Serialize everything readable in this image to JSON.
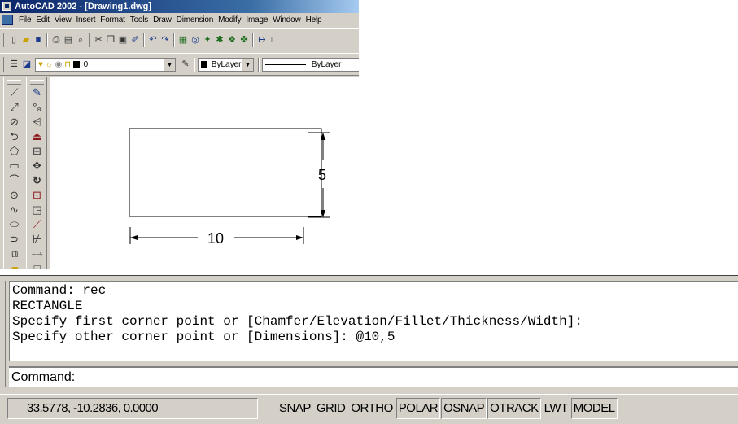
{
  "window": {
    "title": "AutoCAD 2002 - [Drawing1.dwg]"
  },
  "menu": {
    "items": [
      "File",
      "Edit",
      "View",
      "Insert",
      "Format",
      "Tools",
      "Draw",
      "Dimension",
      "Modify",
      "Image",
      "Window",
      "Help"
    ]
  },
  "standard_toolbar": {
    "icons": [
      "new-icon",
      "open-icon",
      "save-icon",
      "print-icon",
      "print-preview-icon",
      "find-icon",
      "cut-icon",
      "copy-icon",
      "paste-icon",
      "match-properties-icon",
      "undo-icon",
      "redo-icon",
      "hyperlink-icon",
      "browser-icon",
      "realtime-pan-icon",
      "realtime-zoom-icon",
      "zoom-icon",
      "properties-icon",
      "distance-icon",
      "ucs-icon"
    ]
  },
  "properties_toolbar": {
    "layer_value": "0",
    "color_value": "ByLayer",
    "linetype_value": "ByLayer"
  },
  "drawing": {
    "width_label": "10",
    "height_label": "5",
    "colors": {
      "geometry": "#000000",
      "background": "#ffffff"
    }
  },
  "command_window": {
    "history": [
      "Command: rec",
      "RECTANGLE",
      "Specify first corner point or [Chamfer/Elevation/Fillet/Thickness/Width]:",
      "Specify other corner point or [Dimensions]: @10,5"
    ],
    "prompt": "Command:"
  },
  "status_bar": {
    "coordinates": "33.5778, -10.2836, 0.0000",
    "toggles": [
      {
        "label": "SNAP",
        "on": false
      },
      {
        "label": "GRID",
        "on": false
      },
      {
        "label": "ORTHO",
        "on": false
      },
      {
        "label": "POLAR",
        "on": true
      },
      {
        "label": "OSNAP",
        "on": true
      },
      {
        "label": "OTRACK",
        "on": true
      },
      {
        "label": "LWT",
        "on": false
      },
      {
        "label": "MODEL",
        "on": true
      }
    ]
  },
  "theme": {
    "face": "#d4d0c8",
    "title_start": "#0a246a",
    "title_end": "#a6caf0"
  }
}
